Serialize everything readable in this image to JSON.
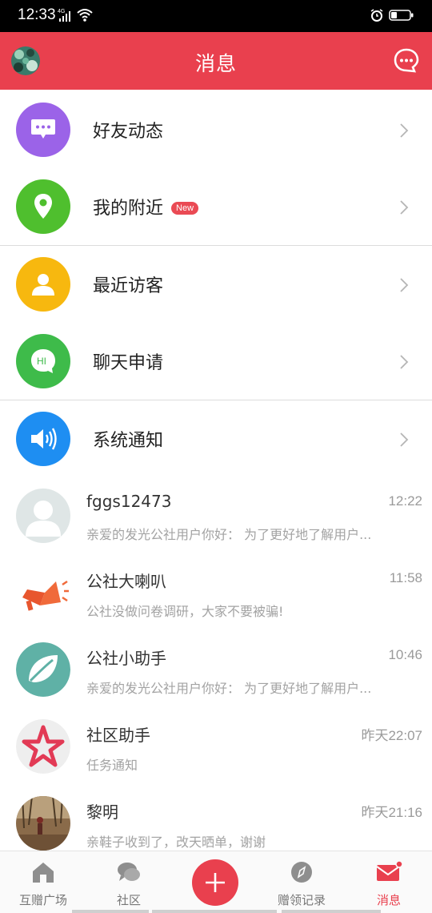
{
  "status_bar": {
    "time": "12:33",
    "network": "4G"
  },
  "app_bar": {
    "title": "消息"
  },
  "features": [
    {
      "label": "好友动态",
      "icon": "chat-bubble-icon",
      "color": "#9b63e8",
      "badge": ""
    },
    {
      "label": "我的附近",
      "icon": "location-pin-icon",
      "color": "#4fbf2e",
      "badge": "New"
    },
    {
      "label": "最近访客",
      "icon": "person-icon",
      "color": "#f7b80f",
      "badge": ""
    },
    {
      "label": "聊天申请",
      "icon": "hi-bubble-icon",
      "color": "#3ebb4a",
      "badge": ""
    },
    {
      "label": "系统通知",
      "icon": "speaker-icon",
      "color": "#1e8ef2",
      "badge": ""
    }
  ],
  "messages": [
    {
      "name": "fggs12473",
      "time": "12:22",
      "preview": "亲爱的发光公社用户你好： 为了更好地了解用户..."
    },
    {
      "name": "公社大喇叭",
      "time": "11:58",
      "preview": "公社没做问卷调研，大家不要被骗!"
    },
    {
      "name": "公社小助手",
      "time": "10:46",
      "preview": "亲爱的发光公社用户你好： 为了更好地了解用户..."
    },
    {
      "name": "社区助手",
      "time": "昨天22:07",
      "preview": "任务通知"
    },
    {
      "name": "黎明",
      "time": "昨天21:16",
      "preview": "亲鞋子收到了，改天晒单，谢谢"
    }
  ],
  "tabs": [
    {
      "label": "互赠广场",
      "icon": "home-icon"
    },
    {
      "label": "社区",
      "icon": "community-icon"
    },
    {
      "label": "",
      "icon": "add-icon"
    },
    {
      "label": "赠领记录",
      "icon": "compass-icon"
    },
    {
      "label": "消息",
      "icon": "mail-icon",
      "active": true
    }
  ],
  "colors": {
    "accent": "#e9404e"
  }
}
